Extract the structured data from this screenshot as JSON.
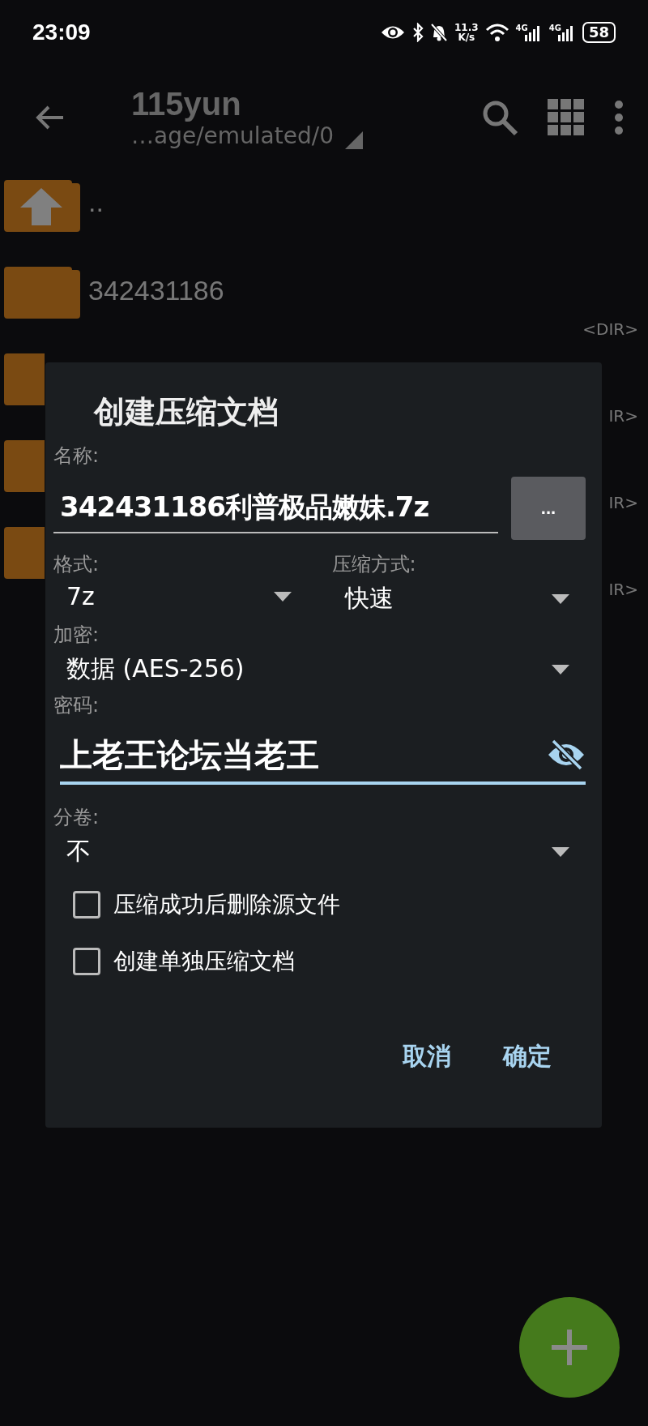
{
  "status_bar": {
    "time": "23:09",
    "net_speed": [
      "11.3",
      "K/s"
    ],
    "signals": [
      "4G",
      "4G"
    ],
    "battery": "58"
  },
  "app_bar": {
    "title": "115yun",
    "path": "…age/emulated/0"
  },
  "files": [
    {
      "kind": "up",
      "name": ".."
    },
    {
      "kind": "folder",
      "name": "342431186",
      "tag": "<DIR>"
    },
    {
      "kind": "folder-clipped",
      "tag": "IR>"
    },
    {
      "kind": "folder-clipped",
      "tag": "IR>"
    },
    {
      "kind": "folder-clipped",
      "tag": "IR>"
    }
  ],
  "dialog": {
    "title": "创建压缩文档",
    "name_label": "名称:",
    "name_value": "342431186利普极品嫩妹.7z",
    "browse_button": "...",
    "format_label": "格式:",
    "format_value": "7z",
    "method_label": "压缩方式:",
    "method_value": "快速",
    "encryption_label": "加密:",
    "encryption_value": "数据 (AES-256)",
    "password_label": "密码:",
    "password_value": "上老王论坛当老王",
    "split_label": "分卷:",
    "split_value": "不",
    "options": [
      {
        "label": "压缩成功后删除源文件",
        "checked": false
      },
      {
        "label": "创建单独压缩文档",
        "checked": false
      }
    ],
    "buttons": [
      "取消",
      "确定"
    ]
  }
}
